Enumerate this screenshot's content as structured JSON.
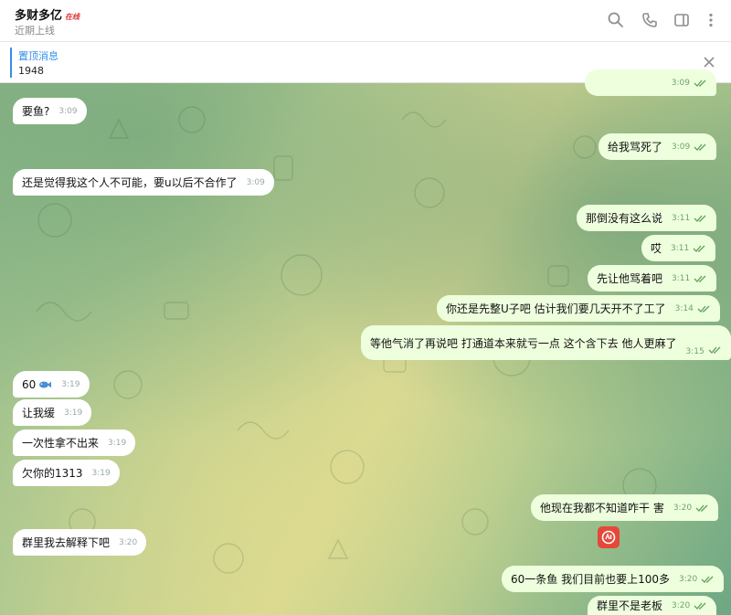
{
  "header": {
    "title": "多财多亿",
    "online_tag": "在线",
    "subtitle": "近期上线",
    "icons": [
      "search-icon",
      "phone-icon",
      "sidebar-icon",
      "more-icon"
    ]
  },
  "pinned": {
    "title": "置顶消息",
    "text": "1948"
  },
  "messages": [
    {
      "dir": "out",
      "text": "",
      "time": "3:09",
      "clipped": true
    },
    {
      "dir": "in",
      "text": "要鱼?",
      "time": "3:09"
    },
    {
      "dir": "out",
      "text": "给我骂死了",
      "time": "3:09"
    },
    {
      "dir": "in",
      "text": "还是觉得我这个人不可能，要u以后不合作了",
      "time": "3:09"
    },
    {
      "dir": "out",
      "text": "那倒没有这么说",
      "time": "3:11"
    },
    {
      "dir": "out",
      "text": "哎",
      "time": "3:11"
    },
    {
      "dir": "out",
      "text": "先让他骂着吧",
      "time": "3:11"
    },
    {
      "dir": "out",
      "text": "你还是先整U子吧 估计我们要几天开不了工了",
      "time": "3:14"
    },
    {
      "dir": "out",
      "text": "等他气消了再说吧 打通道本来就亏一点 这个含下去 他人更麻了",
      "time": "3:15"
    },
    {
      "dir": "in",
      "text": "60",
      "time": "3:19",
      "emoji": "fish-icon"
    },
    {
      "dir": "in",
      "text": "让我缓",
      "time": "3:19"
    },
    {
      "dir": "in",
      "text": "一次性拿不出来",
      "time": "3:19"
    },
    {
      "dir": "in",
      "text": "欠你的1313",
      "time": "3:19"
    },
    {
      "dir": "out",
      "text": "他现在我都不知道咋干 害",
      "time": "3:20"
    },
    {
      "dir": "in",
      "text": "群里我去解释下吧",
      "time": "3:20"
    },
    {
      "dir": "out",
      "text": "60一条鱼 我们目前也要上100多",
      "time": "3:20"
    },
    {
      "dir": "out",
      "text": "群里不是老板",
      "time": "3:20"
    }
  ],
  "reaction": "badge-icon"
}
